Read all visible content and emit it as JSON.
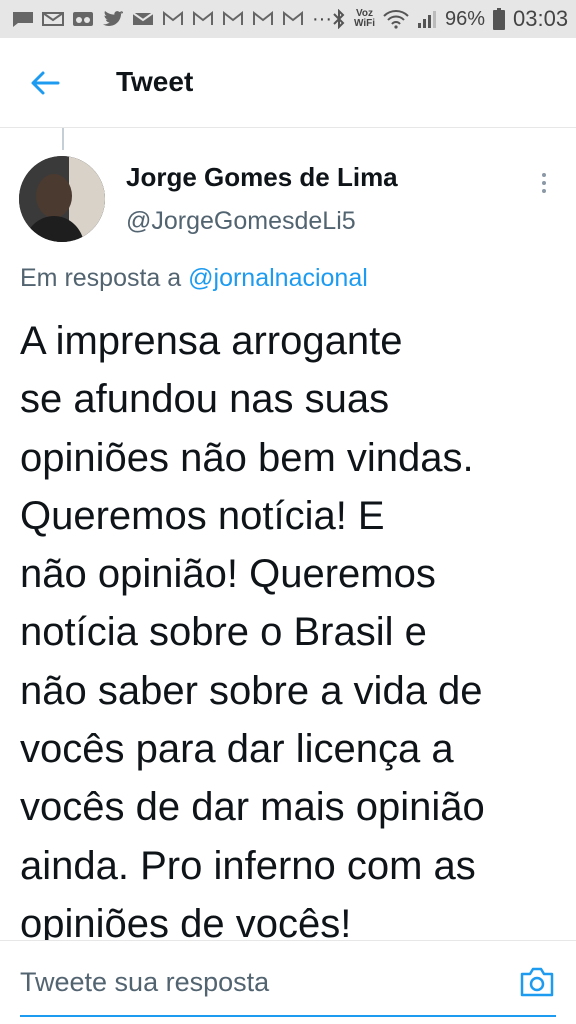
{
  "status_bar": {
    "voz_wifi_top": "Voz",
    "voz_wifi_bottom": "WiFi",
    "battery": "96%",
    "time": "03:03",
    "dots": "···"
  },
  "header": {
    "title": "Tweet",
    "accent": "#1d9bf0"
  },
  "tweet": {
    "author_name": "Jorge Gomes de Lima",
    "author_handle": "@JorgeGomesdeLi5",
    "reply_prefix": "Em resposta a ",
    "reply_mention": "@jornalnacional",
    "text": "A imprensa arrogante\nse afundou nas suas\nopiniões não bem vindas.\nQueremos notícia! E\nnão opinião! Queremos\nnotícia sobre o Brasil e\nnão saber sobre a vida de\nvocês para dar licença a\nvocês de dar mais opinião\nainda. Pro inferno com as\nopiniões de vocês!"
  },
  "reply": {
    "placeholder": "Tweete sua resposta"
  }
}
